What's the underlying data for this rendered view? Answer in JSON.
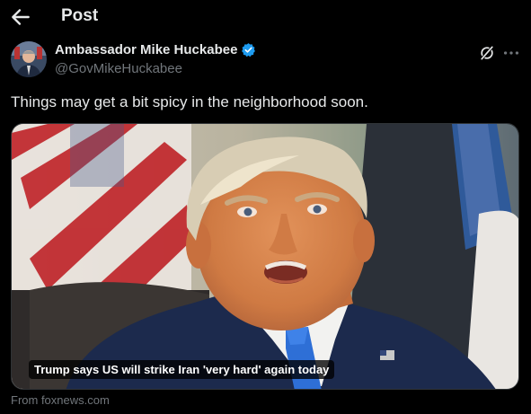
{
  "header": {
    "title": "Post",
    "back_icon": "arrow-left-icon"
  },
  "author": {
    "name": "Ambassador Mike Huckabee",
    "handle": "@GovMikeHuckabee",
    "verified": true,
    "verified_color": "#1d9bf0"
  },
  "actions": {
    "grok_icon": "grok-icon",
    "more_icon": "more-icon"
  },
  "tweet": {
    "text": "Things may get a bit spicy in the neighborhood soon."
  },
  "card": {
    "caption": "Trump says US will strike Iran 'very hard' again today",
    "source": "From foxnews.com"
  },
  "colors": {
    "text": "#e7e9ea",
    "secondary": "#71767b",
    "background": "#000000",
    "border": "#2f3336"
  }
}
